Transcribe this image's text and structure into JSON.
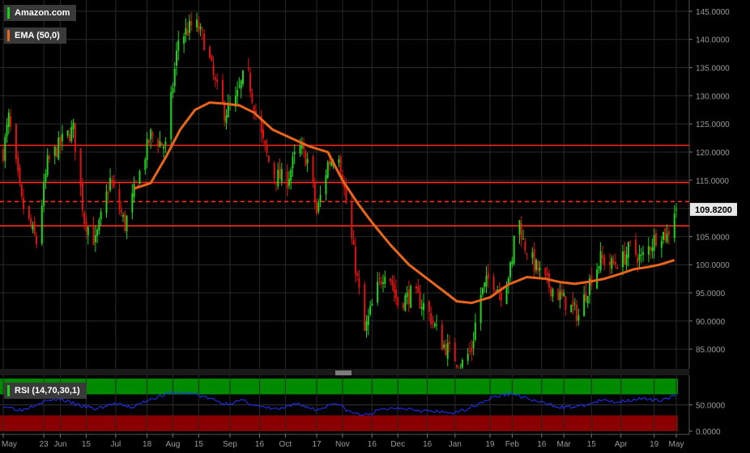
{
  "legend": {
    "main_series": "Amazon.com",
    "main_color": "#19d119",
    "ema_label": "EMA (50,0)",
    "ema_color": "#e8661c",
    "rsi_label": "RSI (14,70,30,1)",
    "rsi_color": "#19d119"
  },
  "colors": {
    "background": "#000000",
    "grid": "#2a2a2a",
    "up_candle": "#1fd41f",
    "down_candle": "#e01212",
    "level_line": "#ff2a1a",
    "ema_line": "#e8661c",
    "rsi_line": "#2233ff",
    "rsi_overbought": "#008a00",
    "rsi_oversold": "#8a0000",
    "price_tag_bg": "#e8e8e8"
  },
  "price_tag": "109.8200",
  "chart_data": [
    {
      "type": "candlestick",
      "title": "Amazon.com",
      "xlabel": "",
      "ylabel": "",
      "ylim": [
        81.5,
        147
      ],
      "y_ticks": [
        "145.0000",
        "140.0000",
        "135.0000",
        "130.0000",
        "125.0000",
        "120.0000",
        "115.0000",
        "110.0000",
        "105.0000",
        "100.0000",
        "95.0000",
        "90.0000",
        "85.0000"
      ],
      "y_tick_values": [
        145,
        140,
        135,
        130,
        125,
        120,
        115,
        110,
        105,
        100,
        95,
        90,
        85
      ],
      "x_ticks": [
        "May",
        "23",
        "Jun",
        "15",
        "Jul",
        "18",
        "Aug",
        "15",
        "Sep",
        "16",
        "Oct",
        "17",
        "Nov",
        "16",
        "Dec",
        "16",
        "Jan",
        "19",
        "Feb",
        "16",
        "Mar",
        "15",
        "Apr",
        "19",
        "May"
      ],
      "x_tick_days": [
        0,
        22,
        31,
        45,
        61,
        78,
        92,
        106,
        123,
        139,
        153,
        170,
        184,
        200,
        214,
        230,
        245,
        264,
        276,
        292,
        304,
        319,
        335,
        353,
        365
      ],
      "last_price": 109.82,
      "horizontal_levels": [
        {
          "value": 121.2,
          "style": "solid"
        },
        {
          "value": 114.6,
          "style": "solid"
        },
        {
          "value": 111.2,
          "style": "dashed"
        },
        {
          "value": 106.9,
          "style": "solid"
        }
      ],
      "price_anchors": [
        {
          "day": 0,
          "price": 120
        },
        {
          "day": 3,
          "price": 126
        },
        {
          "day": 10,
          "price": 111
        },
        {
          "day": 18,
          "price": 104
        },
        {
          "day": 24,
          "price": 118
        },
        {
          "day": 32,
          "price": 122
        },
        {
          "day": 38,
          "price": 124
        },
        {
          "day": 44,
          "price": 108
        },
        {
          "day": 50,
          "price": 104
        },
        {
          "day": 58,
          "price": 115
        },
        {
          "day": 66,
          "price": 107
        },
        {
          "day": 72,
          "price": 114
        },
        {
          "day": 80,
          "price": 123
        },
        {
          "day": 88,
          "price": 121
        },
        {
          "day": 95,
          "price": 140
        },
        {
          "day": 104,
          "price": 143
        },
        {
          "day": 110,
          "price": 139
        },
        {
          "day": 115,
          "price": 132
        },
        {
          "day": 120,
          "price": 127
        },
        {
          "day": 126,
          "price": 129
        },
        {
          "day": 132,
          "price": 135
        },
        {
          "day": 138,
          "price": 125
        },
        {
          "day": 146,
          "price": 116
        },
        {
          "day": 154,
          "price": 115
        },
        {
          "day": 160,
          "price": 121
        },
        {
          "day": 166,
          "price": 118
        },
        {
          "day": 170,
          "price": 109
        },
        {
          "day": 176,
          "price": 118
        },
        {
          "day": 182,
          "price": 120
        },
        {
          "day": 186,
          "price": 111
        },
        {
          "day": 190,
          "price": 102
        },
        {
          "day": 196,
          "price": 88
        },
        {
          "day": 202,
          "price": 95
        },
        {
          "day": 208,
          "price": 100
        },
        {
          "day": 214,
          "price": 93
        },
        {
          "day": 222,
          "price": 95
        },
        {
          "day": 230,
          "price": 92
        },
        {
          "day": 238,
          "price": 86
        },
        {
          "day": 244,
          "price": 84
        },
        {
          "day": 248,
          "price": 82
        },
        {
          "day": 254,
          "price": 85
        },
        {
          "day": 258,
          "price": 94
        },
        {
          "day": 264,
          "price": 98
        },
        {
          "day": 270,
          "price": 95
        },
        {
          "day": 276,
          "price": 100
        },
        {
          "day": 278,
          "price": 111
        },
        {
          "day": 282,
          "price": 104
        },
        {
          "day": 288,
          "price": 100
        },
        {
          "day": 294,
          "price": 97
        },
        {
          "day": 300,
          "price": 95
        },
        {
          "day": 306,
          "price": 93
        },
        {
          "day": 312,
          "price": 91
        },
        {
          "day": 318,
          "price": 97
        },
        {
          "day": 324,
          "price": 101
        },
        {
          "day": 330,
          "price": 100
        },
        {
          "day": 336,
          "price": 101
        },
        {
          "day": 340,
          "price": 103
        },
        {
          "day": 346,
          "price": 101
        },
        {
          "day": 352,
          "price": 104
        },
        {
          "day": 356,
          "price": 106
        },
        {
          "day": 360,
          "price": 105
        },
        {
          "day": 364,
          "price": 109.82
        }
      ],
      "ema_anchors": [
        {
          "day": 71,
          "price": 113.5
        },
        {
          "day": 80,
          "price": 114.5
        },
        {
          "day": 88,
          "price": 119
        },
        {
          "day": 96,
          "price": 124
        },
        {
          "day": 104,
          "price": 127.5
        },
        {
          "day": 112,
          "price": 128.8
        },
        {
          "day": 120,
          "price": 128.6
        },
        {
          "day": 128,
          "price": 128.3
        },
        {
          "day": 136,
          "price": 127
        },
        {
          "day": 146,
          "price": 124
        },
        {
          "day": 156,
          "price": 122.5
        },
        {
          "day": 166,
          "price": 121
        },
        {
          "day": 176,
          "price": 120
        },
        {
          "day": 184,
          "price": 115
        },
        {
          "day": 192,
          "price": 111
        },
        {
          "day": 200,
          "price": 107.5
        },
        {
          "day": 210,
          "price": 103.5
        },
        {
          "day": 220,
          "price": 100
        },
        {
          "day": 230,
          "price": 97.5
        },
        {
          "day": 238,
          "price": 95.5
        },
        {
          "day": 246,
          "price": 93.5
        },
        {
          "day": 254,
          "price": 93.2
        },
        {
          "day": 264,
          "price": 94.2
        },
        {
          "day": 274,
          "price": 96.5
        },
        {
          "day": 284,
          "price": 97.8
        },
        {
          "day": 294,
          "price": 97.5
        },
        {
          "day": 302,
          "price": 96.9
        },
        {
          "day": 310,
          "price": 96.6
        },
        {
          "day": 318,
          "price": 97
        },
        {
          "day": 326,
          "price": 97.5
        },
        {
          "day": 334,
          "price": 98.3
        },
        {
          "day": 342,
          "price": 99.2
        },
        {
          "day": 350,
          "price": 99.6
        },
        {
          "day": 356,
          "price": 100
        },
        {
          "day": 364,
          "price": 100.8
        }
      ]
    },
    {
      "type": "line",
      "title": "RSI (14,70,30,1)",
      "ylim": [
        0,
        100
      ],
      "y_ticks": [
        "50.0000",
        "0.0000"
      ],
      "y_tick_values": [
        50,
        0
      ],
      "overbought": 70,
      "oversold": 30,
      "rsi_anchors": [
        {
          "day": 0,
          "value": 48
        },
        {
          "day": 10,
          "value": 40
        },
        {
          "day": 20,
          "value": 55
        },
        {
          "day": 30,
          "value": 62
        },
        {
          "day": 40,
          "value": 50
        },
        {
          "day": 50,
          "value": 42
        },
        {
          "day": 60,
          "value": 52
        },
        {
          "day": 70,
          "value": 45
        },
        {
          "day": 80,
          "value": 62
        },
        {
          "day": 92,
          "value": 73
        },
        {
          "day": 104,
          "value": 71
        },
        {
          "day": 112,
          "value": 62
        },
        {
          "day": 120,
          "value": 52
        },
        {
          "day": 130,
          "value": 58
        },
        {
          "day": 140,
          "value": 45
        },
        {
          "day": 150,
          "value": 42
        },
        {
          "day": 160,
          "value": 52
        },
        {
          "day": 170,
          "value": 40
        },
        {
          "day": 180,
          "value": 55
        },
        {
          "day": 188,
          "value": 36
        },
        {
          "day": 196,
          "value": 30
        },
        {
          "day": 206,
          "value": 42
        },
        {
          "day": 216,
          "value": 45
        },
        {
          "day": 226,
          "value": 40
        },
        {
          "day": 236,
          "value": 36
        },
        {
          "day": 246,
          "value": 35
        },
        {
          "day": 256,
          "value": 50
        },
        {
          "day": 266,
          "value": 65
        },
        {
          "day": 276,
          "value": 72
        },
        {
          "day": 284,
          "value": 62
        },
        {
          "day": 294,
          "value": 52
        },
        {
          "day": 304,
          "value": 45
        },
        {
          "day": 314,
          "value": 48
        },
        {
          "day": 324,
          "value": 58
        },
        {
          "day": 334,
          "value": 56
        },
        {
          "day": 344,
          "value": 62
        },
        {
          "day": 354,
          "value": 58
        },
        {
          "day": 364,
          "value": 66
        }
      ]
    }
  ]
}
